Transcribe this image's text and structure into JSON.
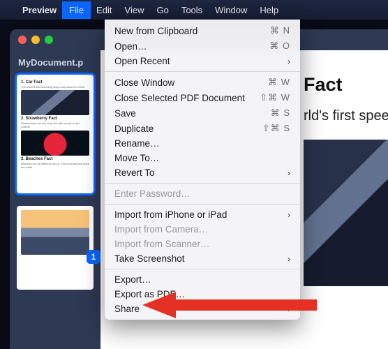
{
  "menubar": {
    "apple": "",
    "appname": "Preview",
    "items": [
      "File",
      "Edit",
      "View",
      "Go",
      "Tools",
      "Window",
      "Help"
    ],
    "active_index": 0
  },
  "window": {
    "doc_tab": "MyDocument.p",
    "page_badge": "1"
  },
  "main": {
    "heading_suffix": "Fact",
    "body_fragment": "rld's first speeding"
  },
  "thumb1": {
    "t1": "1. Car Fact",
    "d1": "The world's first speeding ticket was issued in 1902.",
    "t2": "2. Strawberry Fact",
    "d2": "Strawberries are the only fruit with seeds on the outside.",
    "t3": "3. Beaches Fact",
    "d3": "Beaches are all different colors. The most famous ones are white."
  },
  "menu": {
    "groups": [
      [
        {
          "label": "New from Clipboard",
          "shortcut": "⌘ N"
        },
        {
          "label": "Open…",
          "shortcut": "⌘ O"
        },
        {
          "label": "Open Recent",
          "submenu": true
        }
      ],
      [
        {
          "label": "Close Window",
          "shortcut": "⌘ W"
        },
        {
          "label": "Close Selected PDF Document",
          "shortcut": "⇧⌘ W"
        },
        {
          "label": "Save",
          "shortcut": "⌘ S"
        },
        {
          "label": "Duplicate",
          "shortcut": "⇧⌘ S"
        },
        {
          "label": "Rename…"
        },
        {
          "label": "Move To…"
        },
        {
          "label": "Revert To",
          "submenu": true
        }
      ],
      [
        {
          "label": "Enter Password…",
          "disabled": true
        }
      ],
      [
        {
          "label": "Import from iPhone or iPad",
          "submenu": true
        },
        {
          "label": "Import from Camera…",
          "disabled": true
        },
        {
          "label": "Import from Scanner…",
          "disabled": true
        },
        {
          "label": "Take Screenshot",
          "submenu": true
        }
      ],
      [
        {
          "label": "Export…"
        },
        {
          "label": "Export as PDF…"
        },
        {
          "label": "Share",
          "submenu": true
        }
      ]
    ]
  }
}
